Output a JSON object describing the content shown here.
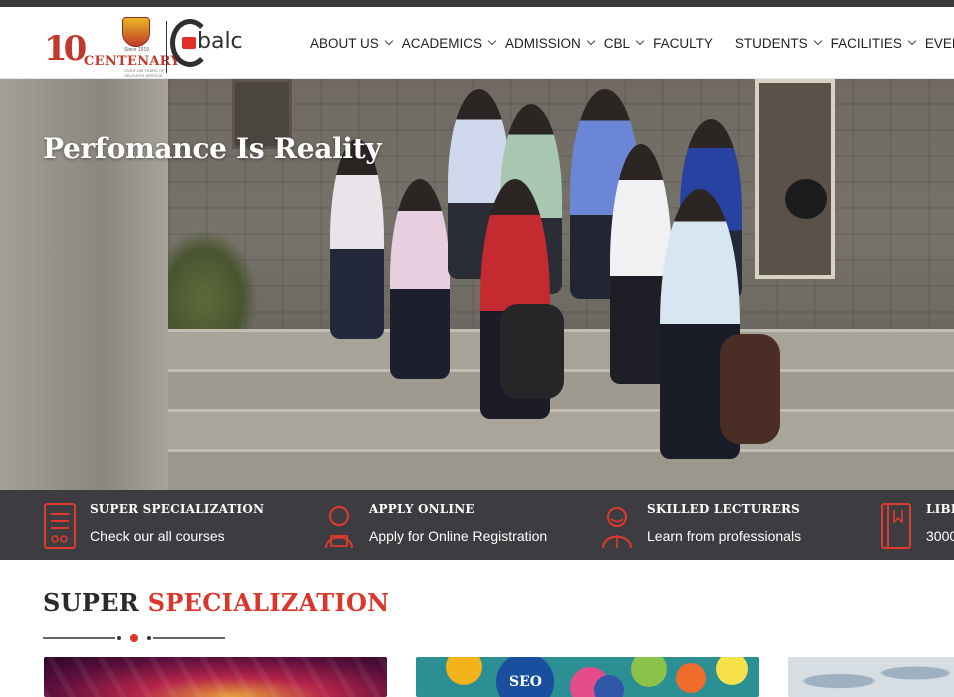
{
  "header": {
    "logo": {
      "centenary_text": "CENTENARY",
      "since_text": "Since 1919",
      "tagline": "OVER 100 YEARS OF SELFLESS SERVICE",
      "hundred": "10",
      "brand": "balc"
    },
    "nav": [
      {
        "label": "ABOUT US",
        "dropdown": true
      },
      {
        "label": "ACADEMICS",
        "dropdown": true
      },
      {
        "label": "ADMISSION",
        "dropdown": true
      },
      {
        "label": "CBL",
        "dropdown": true
      },
      {
        "label": "FACULTY",
        "dropdown": false
      },
      {
        "label": "STUDENTS",
        "dropdown": true
      },
      {
        "label": "FACILITIES",
        "dropdown": true
      },
      {
        "label": "EVENTS",
        "dropdown": false
      }
    ]
  },
  "hero": {
    "title": "Perfomance Is Reality"
  },
  "features": [
    {
      "icon": "document-list-icon",
      "title": "SUPER SPECIALIZATION",
      "subtitle": "Check our all courses"
    },
    {
      "icon": "user-laptop-icon",
      "title": "APPLY ONLINE",
      "subtitle": "Apply for Online Registration"
    },
    {
      "icon": "teacher-icon",
      "title": "SKILLED LECTURERS",
      "subtitle": "Learn from professionals"
    },
    {
      "icon": "book-icon",
      "title": "LIBR",
      "subtitle": "3000"
    }
  ],
  "section": {
    "title_part1": "SUPER",
    "title_part2": "SPECIALIZATION"
  },
  "cards": [
    {
      "image": "event-stage-image"
    },
    {
      "image": "seo-social-image",
      "text_seo": "SEO"
    },
    {
      "image": "world-map-image"
    }
  ],
  "colors": {
    "accent": "#d9372b",
    "dark_band": "#3d3d41",
    "topbar": "#3a3a3d"
  }
}
